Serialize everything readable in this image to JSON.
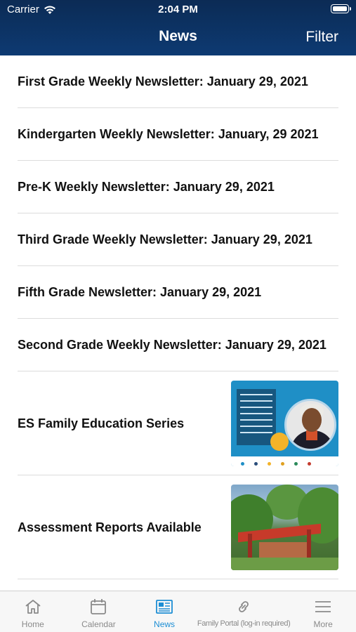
{
  "status_bar": {
    "carrier": "Carrier",
    "time": "2:04 PM"
  },
  "nav": {
    "title": "News",
    "filter_label": "Filter"
  },
  "news_items": [
    {
      "title": "First Grade Weekly Newsletter: January 29, 2021"
    },
    {
      "title": "Kindergarten Weekly Newsletter: January, 29 2021"
    },
    {
      "title": "Pre-K Weekly Newsletter: January 29, 2021"
    },
    {
      "title": "Third Grade Weekly Newsletter: January 29, 2021"
    },
    {
      "title": "Fifth Grade Newsletter: January 29, 2021"
    },
    {
      "title": "Second Grade Weekly Newsletter: January 29, 2021"
    },
    {
      "title": "ES Family Education Series",
      "image": "speaker-series-flyer"
    },
    {
      "title": "Assessment Reports Available",
      "image": "school-entrance-photo"
    }
  ],
  "tabs": [
    {
      "label": "Home",
      "icon": "home-icon",
      "active": false
    },
    {
      "label": "Calendar",
      "icon": "calendar-icon",
      "active": false
    },
    {
      "label": "News",
      "icon": "newspaper-icon",
      "active": true
    },
    {
      "label": "Family Portal (log-in required)",
      "icon": "link-icon",
      "active": false
    },
    {
      "label": "More",
      "icon": "menu-icon",
      "active": false
    }
  ],
  "colors": {
    "header_top": "#0c2b55",
    "header_bottom": "#0d3a72",
    "tab_active": "#1d8ed4",
    "tab_inactive": "#8a8a8a"
  }
}
